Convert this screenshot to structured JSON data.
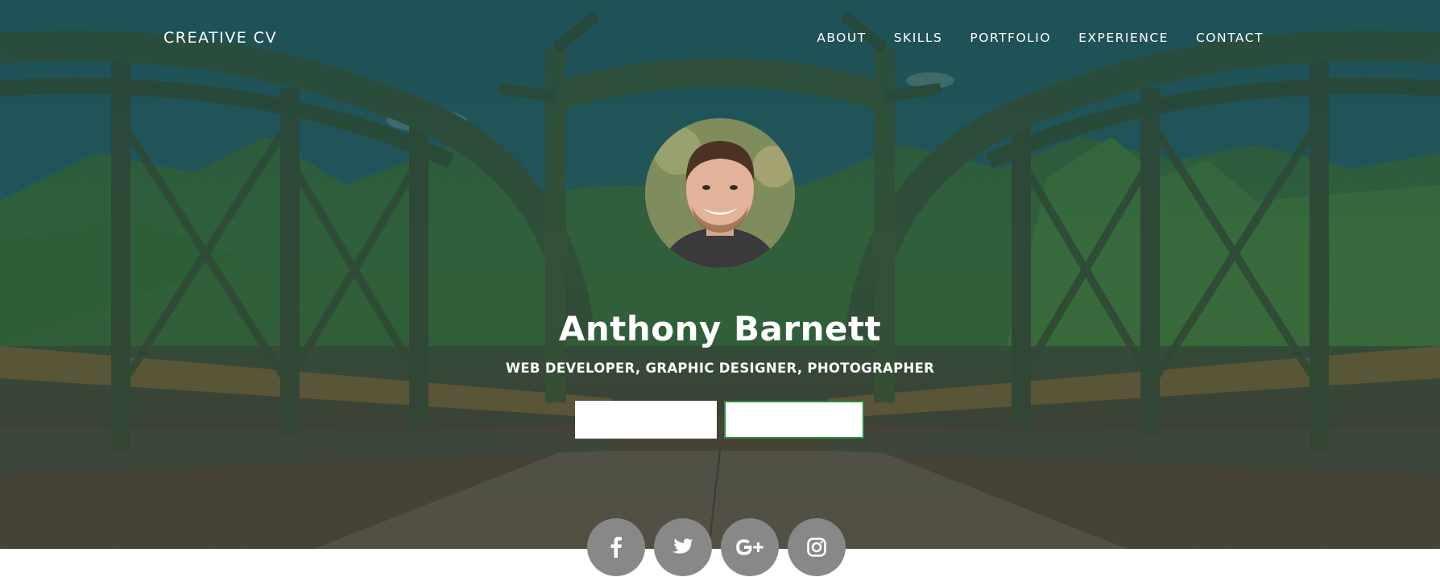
{
  "navbar": {
    "brand": "CREATIVE CV",
    "links": [
      {
        "label": "ABOUT"
      },
      {
        "label": "SKILLS"
      },
      {
        "label": "PORTFOLIO"
      },
      {
        "label": "EXPERIENCE"
      },
      {
        "label": "CONTACT"
      }
    ]
  },
  "profile": {
    "name": "Anthony Barnett",
    "subtitle": "WEB DEVELOPER, GRAPHIC DESIGNER, PHOTOGRAPHER",
    "avatar_icon": "profile-photo"
  },
  "buttons": {
    "primary_label": "",
    "secondary_label": ""
  },
  "social": [
    {
      "icon": "facebook-icon"
    },
    {
      "icon": "twitter-icon"
    },
    {
      "icon": "google-plus-icon"
    },
    {
      "icon": "instagram-icon"
    }
  ],
  "colors": {
    "overlay": "#1f5a58",
    "social_button": "#888888",
    "secondary_button_border": "#2f8a3a",
    "text": "#ffffff"
  }
}
